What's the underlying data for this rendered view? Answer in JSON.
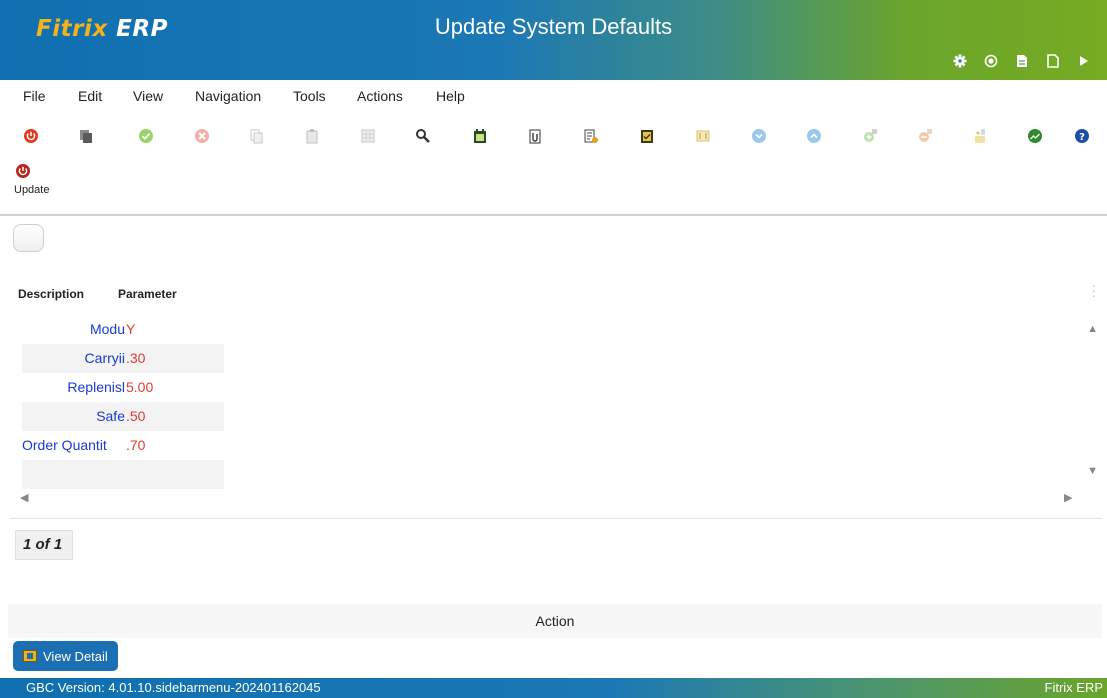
{
  "header": {
    "logo_brand": "Fitrix",
    "logo_suffix": "ERP",
    "title": "Update System Defaults",
    "icons": [
      "gear-icon",
      "target-icon",
      "document-icon",
      "new-document-icon",
      "play-icon"
    ]
  },
  "menu": [
    "File",
    "Edit",
    "View",
    "Navigation",
    "Tools",
    "Actions",
    "Help"
  ],
  "toolbar": {
    "icons": [
      "power-icon",
      "copy-icon",
      "accept-icon",
      "cancel-icon",
      "copy-page-icon",
      "paste-icon",
      "grid-icon",
      "search-icon",
      "calendar-icon",
      "attach-icon",
      "report-icon",
      "checklist-icon",
      "frame-icon",
      "down-arrow-icon",
      "up-arrow-icon",
      "add-icon",
      "delete-icon",
      "info-icon",
      "graph-icon",
      "help-icon"
    ]
  },
  "update_label": "Update",
  "table": {
    "columns": [
      "Description",
      "Parameter"
    ],
    "rows": [
      {
        "description": "Modu",
        "parameter": "Y"
      },
      {
        "description": "Carryii",
        "parameter": ".30"
      },
      {
        "description": "Replenisl",
        "parameter": "5.00"
      },
      {
        "description": "Safe",
        "parameter": ".50"
      },
      {
        "description": "Order Quantit",
        "parameter": ".70"
      },
      {
        "description": "",
        "parameter": ""
      }
    ]
  },
  "pager": "1 of 1",
  "action_label": "Action",
  "view_detail_label": "View Detail",
  "status": {
    "version": "GBC Version: 4.01.10.sidebarmenu-202401162045",
    "app": "Fitrix ERP"
  },
  "colors": {
    "header_blue": "#1b78b5",
    "header_green": "#76ab22",
    "description_text": "#1a39d6",
    "parameter_text": "#e23b2e"
  }
}
